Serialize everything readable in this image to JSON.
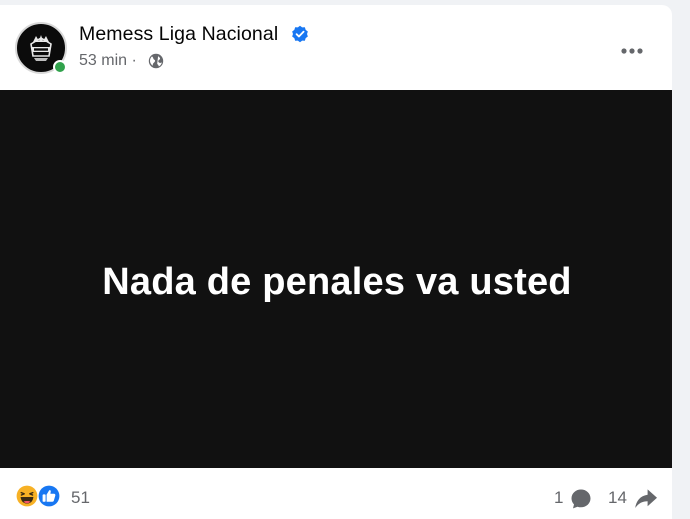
{
  "post": {
    "page_name": "Memess Liga Nacional",
    "time": "53 min",
    "separator": "·",
    "media_text": "Nada de penales va usted"
  },
  "icons": {
    "avatar": "team-crest-logo",
    "verified": "verified-badge-icon",
    "audience": "globe-icon",
    "more": "more-options-icon",
    "reaction_1": "haha-reaction-icon",
    "reaction_2": "like-reaction-icon",
    "comment": "comment-icon",
    "share": "share-icon"
  },
  "stats": {
    "reactions": "51",
    "comments": "1",
    "shares": "14"
  },
  "colors": {
    "verified": "#1877f2",
    "online": "#31a24c",
    "media_bg": "#111111",
    "secondary_text": "#65676b",
    "like": "#1877f2",
    "haha": "#f7b125"
  }
}
